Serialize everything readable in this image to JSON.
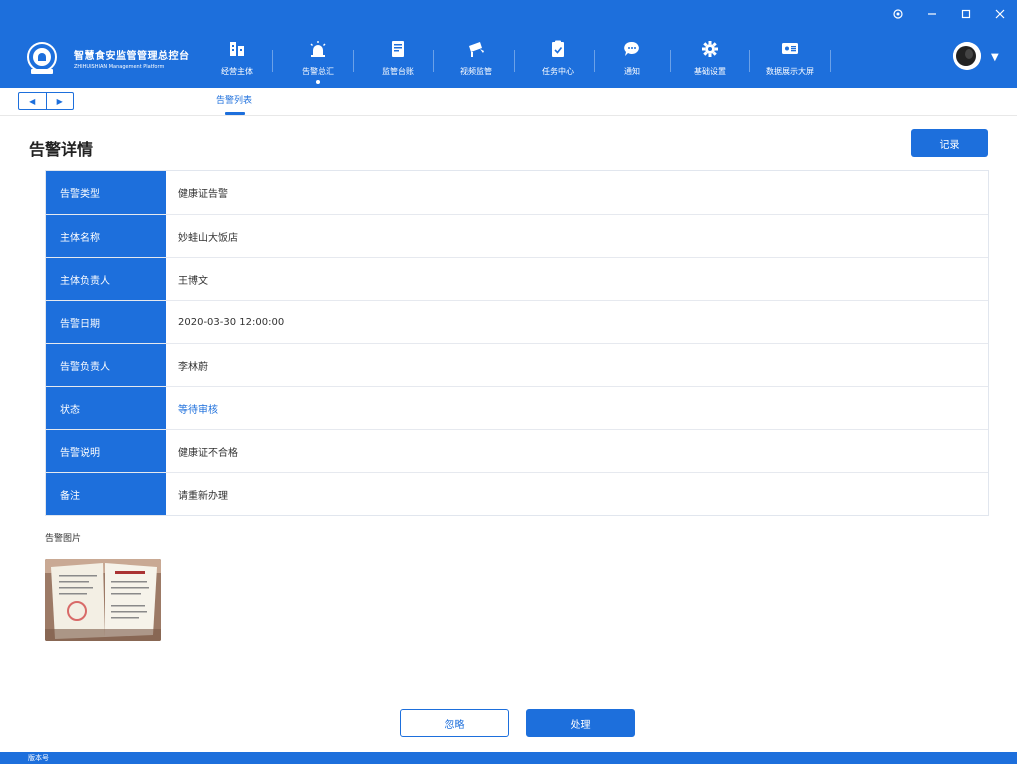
{
  "brand": {
    "name_cn": "智慧食安监管管理总控台",
    "name_en": "ZHIHUISHIAN Management Platform"
  },
  "nav": {
    "items": [
      {
        "label": "经营主体",
        "icon": "building-icon"
      },
      {
        "label": "告警总汇",
        "icon": "alarm-icon",
        "active": true
      },
      {
        "label": "监管台账",
        "icon": "ledger-icon"
      },
      {
        "label": "视频监管",
        "icon": "camera-icon"
      },
      {
        "label": "任务中心",
        "icon": "clipboard-check-icon"
      },
      {
        "label": "通知",
        "icon": "chat-bubble-icon"
      },
      {
        "label": "基础设置",
        "icon": "gear-icon"
      },
      {
        "label": "数据展示大屏",
        "icon": "dashboard-screen-icon"
      }
    ]
  },
  "tabs": {
    "active": "告警列表"
  },
  "page": {
    "title": "告警详情",
    "record_button": "记录"
  },
  "details": {
    "rows": [
      {
        "label": "告警类型",
        "value": "健康证告警"
      },
      {
        "label": "主体名称",
        "value": "妙蛙山大饭店"
      },
      {
        "label": "主体负责人",
        "value": "王博文"
      },
      {
        "label": "告警日期",
        "value": "2020-03-30 12:00:00"
      },
      {
        "label": "告警负责人",
        "value": "李林蔚"
      },
      {
        "label": "状态",
        "value": "等待审核"
      },
      {
        "label": "告警说明",
        "value": "健康证不合格"
      },
      {
        "label": "备注",
        "value": "请重新办理"
      }
    ]
  },
  "photos": {
    "title": "告警图片"
  },
  "actions": {
    "ignore": "忽略",
    "handle": "处理"
  },
  "footer": {
    "text": "版本号"
  },
  "colors": {
    "primary": "#1d6fdc",
    "status_link": "#1d6fdc"
  }
}
